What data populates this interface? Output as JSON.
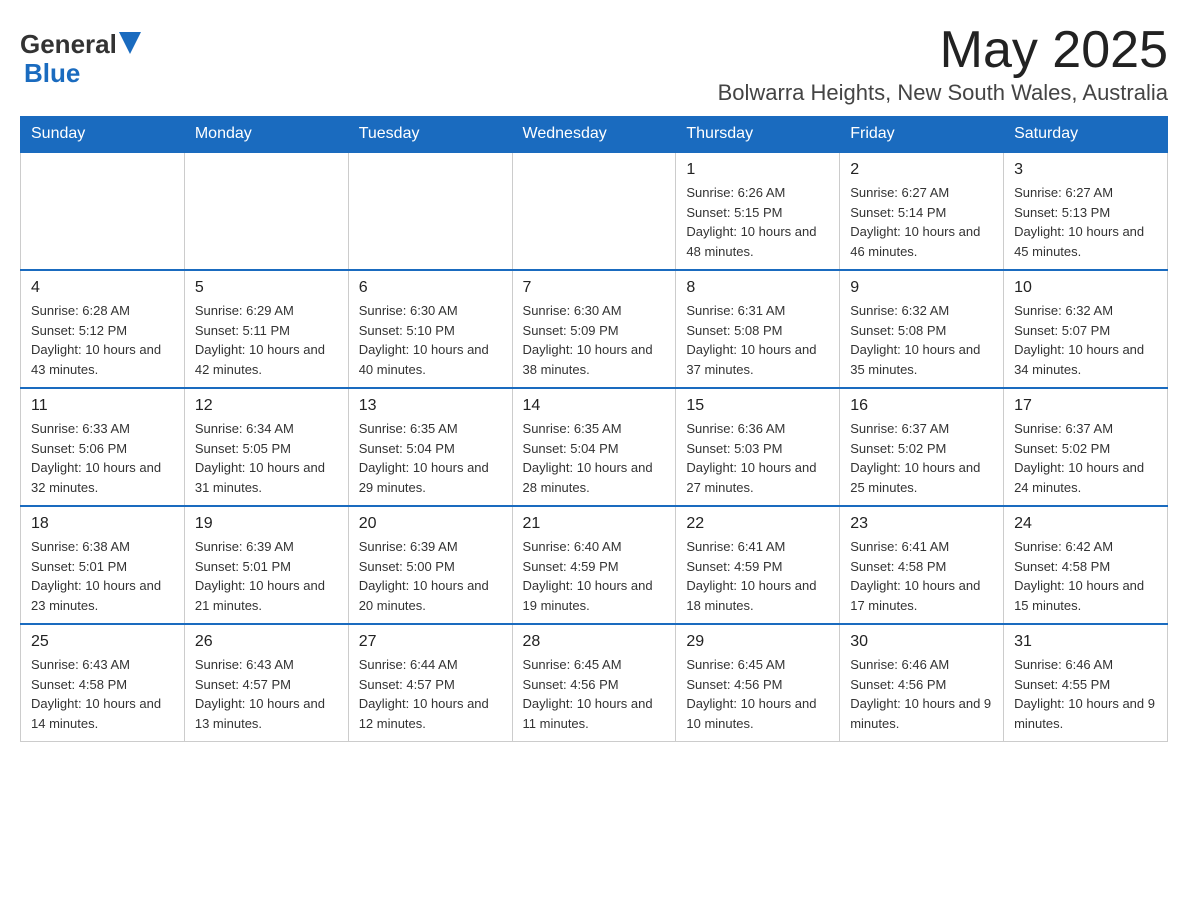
{
  "header": {
    "logo_general": "General",
    "logo_blue": "Blue",
    "month_title": "May 2025",
    "location": "Bolwarra Heights, New South Wales, Australia"
  },
  "days_of_week": [
    "Sunday",
    "Monday",
    "Tuesday",
    "Wednesday",
    "Thursday",
    "Friday",
    "Saturday"
  ],
  "weeks": [
    [
      {
        "day": "",
        "info": ""
      },
      {
        "day": "",
        "info": ""
      },
      {
        "day": "",
        "info": ""
      },
      {
        "day": "",
        "info": ""
      },
      {
        "day": "1",
        "info": "Sunrise: 6:26 AM\nSunset: 5:15 PM\nDaylight: 10 hours and 48 minutes."
      },
      {
        "day": "2",
        "info": "Sunrise: 6:27 AM\nSunset: 5:14 PM\nDaylight: 10 hours and 46 minutes."
      },
      {
        "day": "3",
        "info": "Sunrise: 6:27 AM\nSunset: 5:13 PM\nDaylight: 10 hours and 45 minutes."
      }
    ],
    [
      {
        "day": "4",
        "info": "Sunrise: 6:28 AM\nSunset: 5:12 PM\nDaylight: 10 hours and 43 minutes."
      },
      {
        "day": "5",
        "info": "Sunrise: 6:29 AM\nSunset: 5:11 PM\nDaylight: 10 hours and 42 minutes."
      },
      {
        "day": "6",
        "info": "Sunrise: 6:30 AM\nSunset: 5:10 PM\nDaylight: 10 hours and 40 minutes."
      },
      {
        "day": "7",
        "info": "Sunrise: 6:30 AM\nSunset: 5:09 PM\nDaylight: 10 hours and 38 minutes."
      },
      {
        "day": "8",
        "info": "Sunrise: 6:31 AM\nSunset: 5:08 PM\nDaylight: 10 hours and 37 minutes."
      },
      {
        "day": "9",
        "info": "Sunrise: 6:32 AM\nSunset: 5:08 PM\nDaylight: 10 hours and 35 minutes."
      },
      {
        "day": "10",
        "info": "Sunrise: 6:32 AM\nSunset: 5:07 PM\nDaylight: 10 hours and 34 minutes."
      }
    ],
    [
      {
        "day": "11",
        "info": "Sunrise: 6:33 AM\nSunset: 5:06 PM\nDaylight: 10 hours and 32 minutes."
      },
      {
        "day": "12",
        "info": "Sunrise: 6:34 AM\nSunset: 5:05 PM\nDaylight: 10 hours and 31 minutes."
      },
      {
        "day": "13",
        "info": "Sunrise: 6:35 AM\nSunset: 5:04 PM\nDaylight: 10 hours and 29 minutes."
      },
      {
        "day": "14",
        "info": "Sunrise: 6:35 AM\nSunset: 5:04 PM\nDaylight: 10 hours and 28 minutes."
      },
      {
        "day": "15",
        "info": "Sunrise: 6:36 AM\nSunset: 5:03 PM\nDaylight: 10 hours and 27 minutes."
      },
      {
        "day": "16",
        "info": "Sunrise: 6:37 AM\nSunset: 5:02 PM\nDaylight: 10 hours and 25 minutes."
      },
      {
        "day": "17",
        "info": "Sunrise: 6:37 AM\nSunset: 5:02 PM\nDaylight: 10 hours and 24 minutes."
      }
    ],
    [
      {
        "day": "18",
        "info": "Sunrise: 6:38 AM\nSunset: 5:01 PM\nDaylight: 10 hours and 23 minutes."
      },
      {
        "day": "19",
        "info": "Sunrise: 6:39 AM\nSunset: 5:01 PM\nDaylight: 10 hours and 21 minutes."
      },
      {
        "day": "20",
        "info": "Sunrise: 6:39 AM\nSunset: 5:00 PM\nDaylight: 10 hours and 20 minutes."
      },
      {
        "day": "21",
        "info": "Sunrise: 6:40 AM\nSunset: 4:59 PM\nDaylight: 10 hours and 19 minutes."
      },
      {
        "day": "22",
        "info": "Sunrise: 6:41 AM\nSunset: 4:59 PM\nDaylight: 10 hours and 18 minutes."
      },
      {
        "day": "23",
        "info": "Sunrise: 6:41 AM\nSunset: 4:58 PM\nDaylight: 10 hours and 17 minutes."
      },
      {
        "day": "24",
        "info": "Sunrise: 6:42 AM\nSunset: 4:58 PM\nDaylight: 10 hours and 15 minutes."
      }
    ],
    [
      {
        "day": "25",
        "info": "Sunrise: 6:43 AM\nSunset: 4:58 PM\nDaylight: 10 hours and 14 minutes."
      },
      {
        "day": "26",
        "info": "Sunrise: 6:43 AM\nSunset: 4:57 PM\nDaylight: 10 hours and 13 minutes."
      },
      {
        "day": "27",
        "info": "Sunrise: 6:44 AM\nSunset: 4:57 PM\nDaylight: 10 hours and 12 minutes."
      },
      {
        "day": "28",
        "info": "Sunrise: 6:45 AM\nSunset: 4:56 PM\nDaylight: 10 hours and 11 minutes."
      },
      {
        "day": "29",
        "info": "Sunrise: 6:45 AM\nSunset: 4:56 PM\nDaylight: 10 hours and 10 minutes."
      },
      {
        "day": "30",
        "info": "Sunrise: 6:46 AM\nSunset: 4:56 PM\nDaylight: 10 hours and 9 minutes."
      },
      {
        "day": "31",
        "info": "Sunrise: 6:46 AM\nSunset: 4:55 PM\nDaylight: 10 hours and 9 minutes."
      }
    ]
  ]
}
